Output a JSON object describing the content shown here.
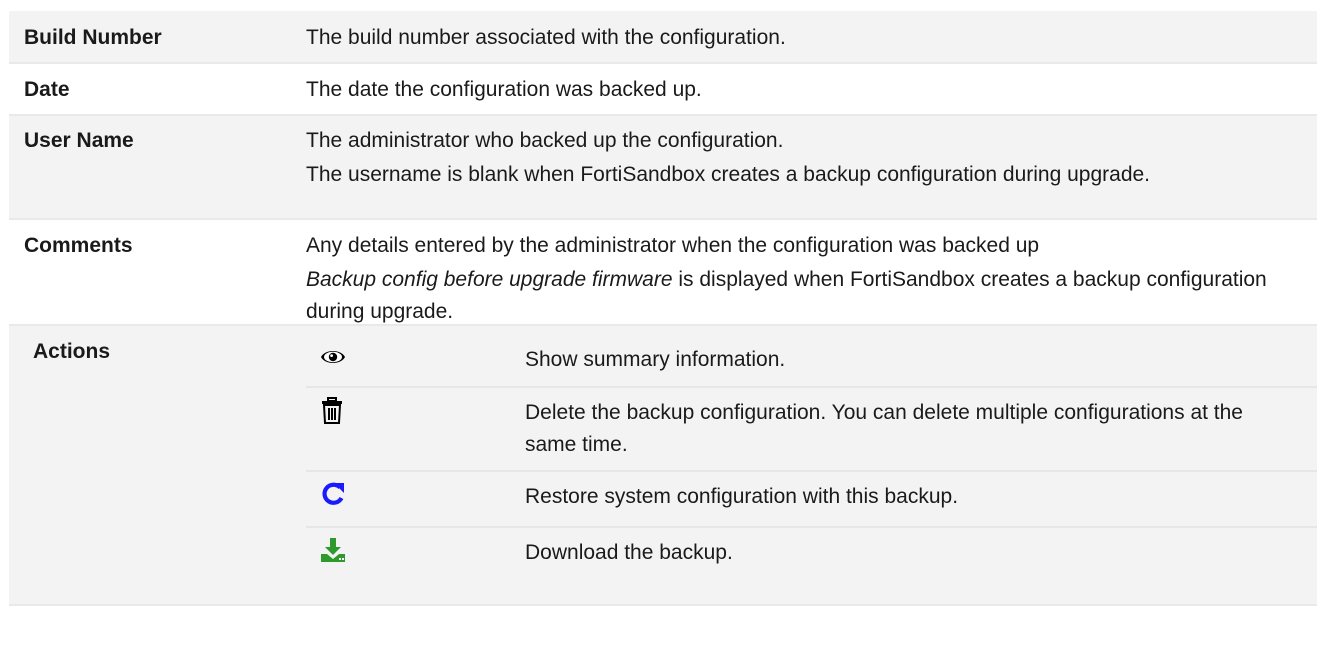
{
  "rows": {
    "build_number": {
      "term": "Build Number",
      "desc": "The build number associated with the configuration."
    },
    "date": {
      "term": "Date",
      "desc": "The date the configuration was backed up."
    },
    "user_name": {
      "term": "User Name",
      "desc_1": "The administrator who backed up the configuration.",
      "desc_2": "The username is blank when FortiSandbox creates a backup configuration during upgrade."
    },
    "comments": {
      "term": "Comments",
      "desc_1": "Any details entered by the administrator when the configuration was backed up",
      "desc_2_italic": "Backup config before upgrade firmware",
      "desc_2_rest": " is displayed when FortiSandbox creates a backup configuration during upgrade."
    },
    "actions": {
      "term": "Actions",
      "items": [
        {
          "icon": "eye-icon",
          "text": "Show summary information.",
          "color": "#000000"
        },
        {
          "icon": "trash-icon",
          "text": "Delete the backup configuration. You can delete multiple configurations at the same time.",
          "color": "#000000"
        },
        {
          "icon": "refresh-icon",
          "text": "Restore system configuration with this backup.",
          "color": "#1a1aff"
        },
        {
          "icon": "download-icon",
          "text": "Download the backup.",
          "color": "#2e9a2e"
        }
      ]
    }
  }
}
